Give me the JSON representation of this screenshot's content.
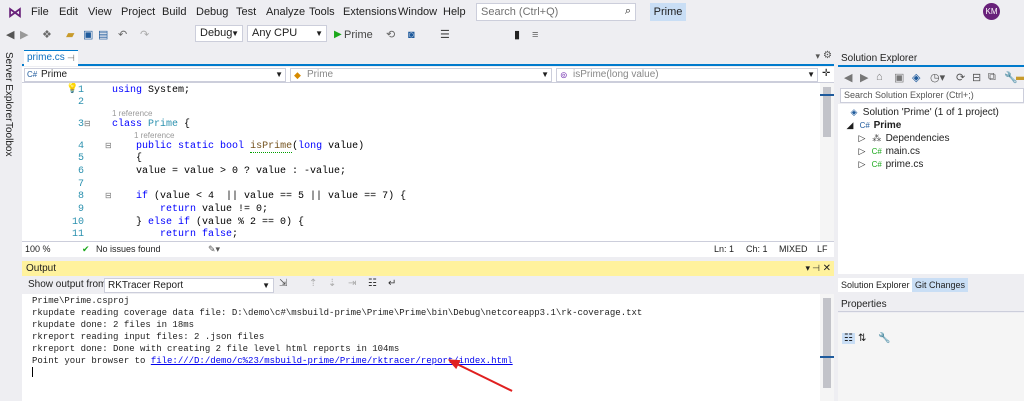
{
  "menu": [
    "File",
    "Edit",
    "View",
    "Project",
    "Build",
    "Debug",
    "Test",
    "Analyze",
    "Tools",
    "Extensions",
    "Window",
    "Help"
  ],
  "search": {
    "placeholder": "Search (Ctrl+Q)"
  },
  "solution_badge": "Prime",
  "avatar": "KM",
  "toolbar": {
    "config": "Debug",
    "platform": "Any CPU",
    "run_label": "Prime"
  },
  "left_tabs": [
    "Server Explorer",
    "Toolbox"
  ],
  "editor": {
    "tab": "prime.cs",
    "nav": {
      "project": "Prime",
      "class": "Prime",
      "member": "isPrime(long value)"
    },
    "lines": [
      {
        "n": "1",
        "code": "using System;"
      },
      {
        "n": "2",
        "code": ""
      },
      {
        "n": "3",
        "code": "class Prime {",
        "ref": "1 reference"
      },
      {
        "n": "4",
        "code": "    public static bool isPrime(long value)",
        "ref": "1 reference"
      },
      {
        "n": "5",
        "code": "    {"
      },
      {
        "n": "6",
        "code": "    value = value > 0 ? value : -value;"
      },
      {
        "n": "7",
        "code": ""
      },
      {
        "n": "8",
        "code": "    if (value < 4  || value == 5 || value == 7) {"
      },
      {
        "n": "9",
        "code": "        return value != 0;"
      },
      {
        "n": "10",
        "code": "    } else if (value % 2 == 0) {"
      },
      {
        "n": "11",
        "code": "        return false;"
      }
    ],
    "status": {
      "zoom": "100 %",
      "issues": "No issues found",
      "ln": "Ln: 1",
      "ch": "Ch: 1",
      "mode": "MIXED",
      "eol": "LF"
    }
  },
  "output": {
    "title": "Output",
    "show_from_label": "Show output from:",
    "source": "RKTracer Report",
    "lines": [
      "Prime\\Prime.csproj",
      "rkupdate reading coverage data file: D:\\demo\\c#\\msbuild-prime\\Prime\\Prime\\bin\\Debug\\netcoreapp3.1\\rk-coverage.txt",
      "rkupdate done: 2 files in 18ms",
      "rkreport reading input files: 2 .json files",
      "rkreport done: Done with creating 2 file level html reports in 104ms"
    ],
    "link_prefix": "Point your browser to ",
    "link": "file:///D:/demo/c%23/msbuild-prime/Prime/rktracer/report/index.html"
  },
  "solution_explorer": {
    "title": "Solution Explorer",
    "search_placeholder": "Search Solution Explorer (Ctrl+;)",
    "tree": [
      {
        "label": "Solution 'Prime' (1 of 1 project)",
        "icon": "solution-icon"
      },
      {
        "label": "Prime",
        "icon": "csharp-project-icon"
      },
      {
        "label": "Dependencies",
        "icon": "dependencies-icon"
      },
      {
        "label": "main.cs",
        "icon": "csharp-file-icon"
      },
      {
        "label": "prime.cs",
        "icon": "csharp-file-icon"
      }
    ],
    "tabs": [
      "Solution Explorer",
      "Git Changes"
    ]
  },
  "properties": {
    "title": "Properties"
  },
  "colors": {
    "accent": "#007ACC",
    "output_header": "#FFF29D",
    "annotation_arrow": "#E02020"
  }
}
